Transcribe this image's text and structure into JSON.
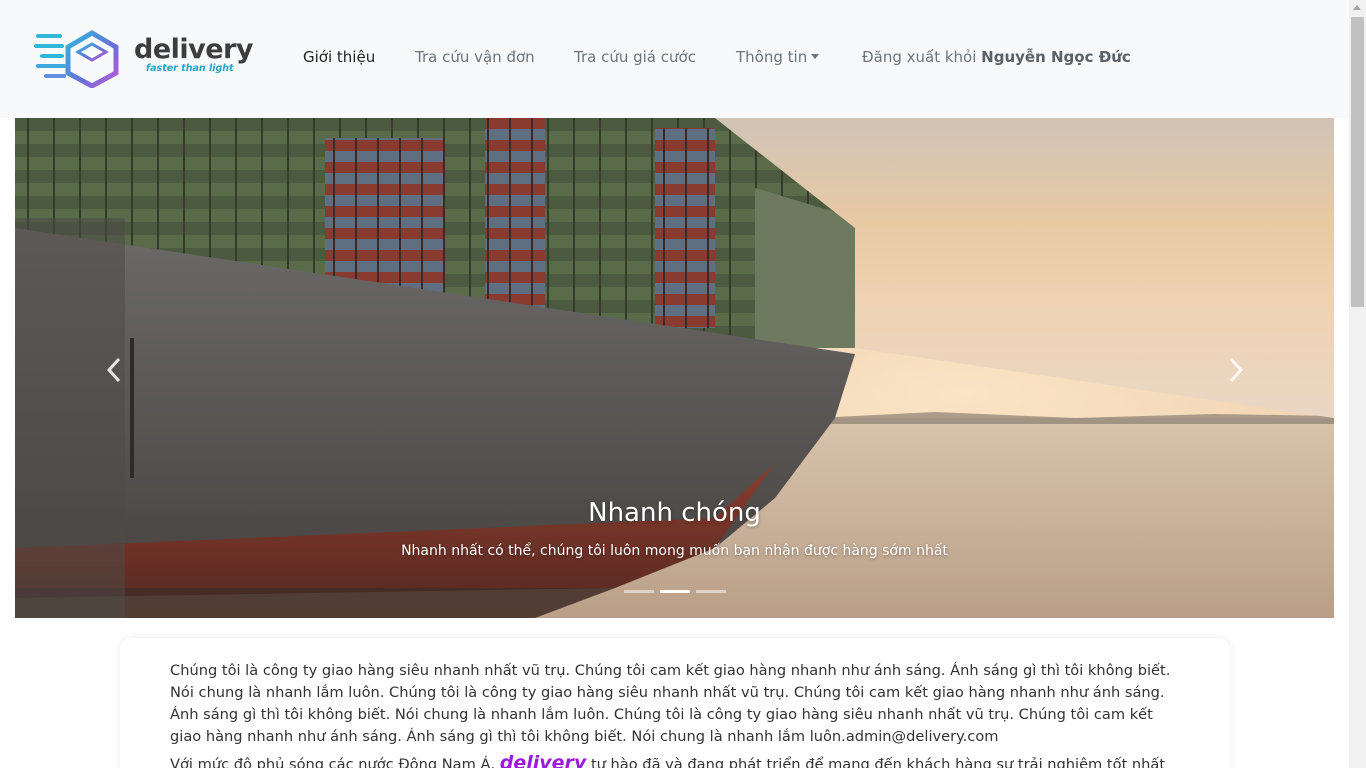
{
  "brand": {
    "name": "delivery",
    "tagline": "faster than light"
  },
  "nav": {
    "items": [
      {
        "label": "Giới thiệu",
        "active": true
      },
      {
        "label": "Tra cứu vận đơn",
        "active": false
      },
      {
        "label": "Tra cứu giá cước",
        "active": false
      },
      {
        "label": "Thông tin",
        "active": false,
        "dropdown": true
      }
    ],
    "logout_prefix": "Đăng xuất khỏi",
    "user_name": "Nguyễn Ngọc Đức"
  },
  "carousel": {
    "slide_title": "Nhanh chóng",
    "slide_subtitle": "Nhanh nhất có thể, chúng tôi luôn mong muốn bạn nhận được hàng sớm nhất",
    "slide_count": 3,
    "active_index": 1,
    "prev_icon": "chevron-left-icon",
    "next_icon": "chevron-right-icon"
  },
  "about": {
    "paragraph": "Chúng tôi là công ty giao hàng siêu nhanh nhất vũ trụ. Chúng tôi cam kết giao hàng nhanh như ánh sáng. Ánh sáng gì thì tôi không biết. Nói chung là nhanh lắm luôn. Chúng tôi là công ty giao hàng siêu nhanh nhất vũ trụ. Chúng tôi cam kết giao hàng nhanh như ánh sáng. Ánh sáng gì thì tôi không biết. Nói chung là nhanh lắm luôn. Chúng tôi là công ty giao hàng siêu nhanh nhất vũ trụ. Chúng tôi cam kết giao hàng nhanh như ánh sáng. Ánh sáng gì thì tôi không biết. Nói chung là nhanh lắm luôn.admin@delivery.com",
    "coverage_prefix": "Với mức độ phủ sóng các nước Đông Nam Á,",
    "coverage_brand": "delivery",
    "coverage_suffix": "tự hào đã và đang phát triển để mang đến khách hàng sự trải nghiệm tốt nhất"
  },
  "colors": {
    "accent": "#1a8f7a",
    "brand_purple": "#9b1cd8",
    "brand_cyan": "#27a3c6"
  }
}
